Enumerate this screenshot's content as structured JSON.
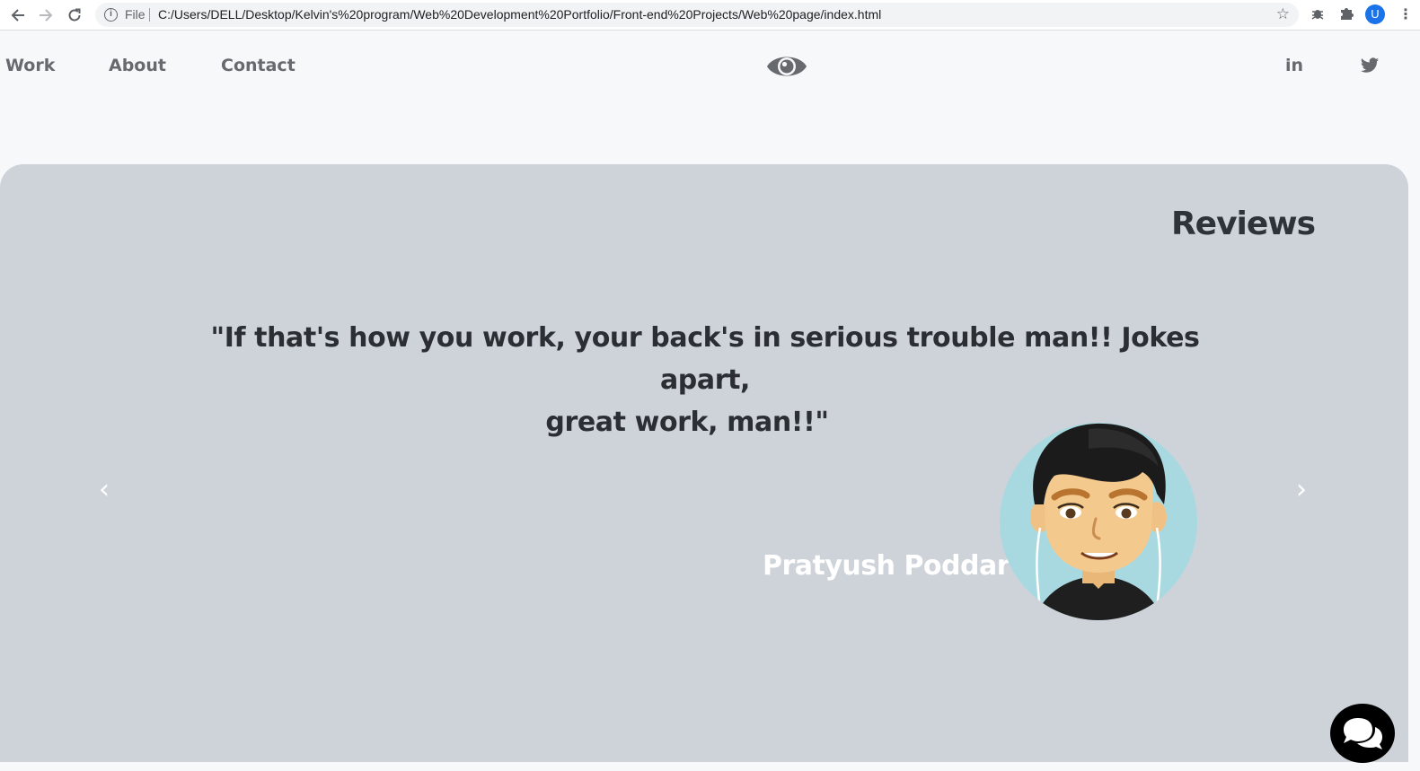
{
  "browser": {
    "file_label": "File",
    "url": "C:/Users/DELL/Desktop/Kelvin's%20program/Web%20Development%20Portfolio/Front-end%20Projects/Web%20page/index.html",
    "profile_initial": "U",
    "icons": [
      "back-arrow-icon",
      "forward-arrow-icon",
      "reload-icon",
      "info-icon",
      "star-icon",
      "extension-bug-icon",
      "puzzle-icon",
      "kebab-menu-icon"
    ]
  },
  "site_nav": {
    "items": [
      "Work",
      "About",
      "Contact"
    ]
  },
  "logo": {
    "icon": "eye-icon"
  },
  "social": {
    "linkedin_label": "in",
    "twitter_icon": "twitter-bird-icon"
  },
  "reviews": {
    "title": "Reviews",
    "quote_line1": "\"If that's how you work, your back's in serious trouble man!! Jokes apart,",
    "quote_line2": "great work, man!!\"",
    "reviewer_name": "Pratyush Poddar",
    "prev_label": "‹",
    "next_label": "›"
  },
  "colors": {
    "panel_bg": "#ced2d9",
    "page_bg": "#f7f8f9",
    "text_dark": "#2b2e33",
    "nav_text": "#666a6e",
    "avatar_bg": "#a9d9e0"
  }
}
